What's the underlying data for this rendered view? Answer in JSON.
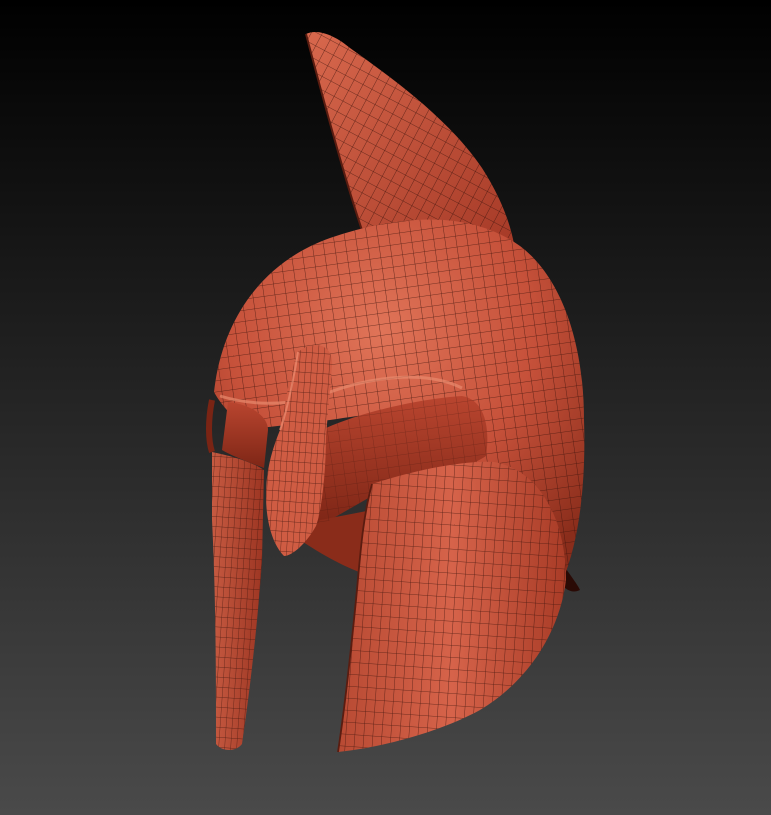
{
  "scene": {
    "subject_icon": "corinthian-helmet-icon",
    "render_style": "wireframe-over-shaded",
    "colors": {
      "background_top": "#000000",
      "background_bottom": "#4a4a4a",
      "material_light": "#e07458",
      "material_base": "#c6513a",
      "material_dark": "#7a2414",
      "interior": "#9a3523",
      "wire": "#3a120a"
    }
  }
}
